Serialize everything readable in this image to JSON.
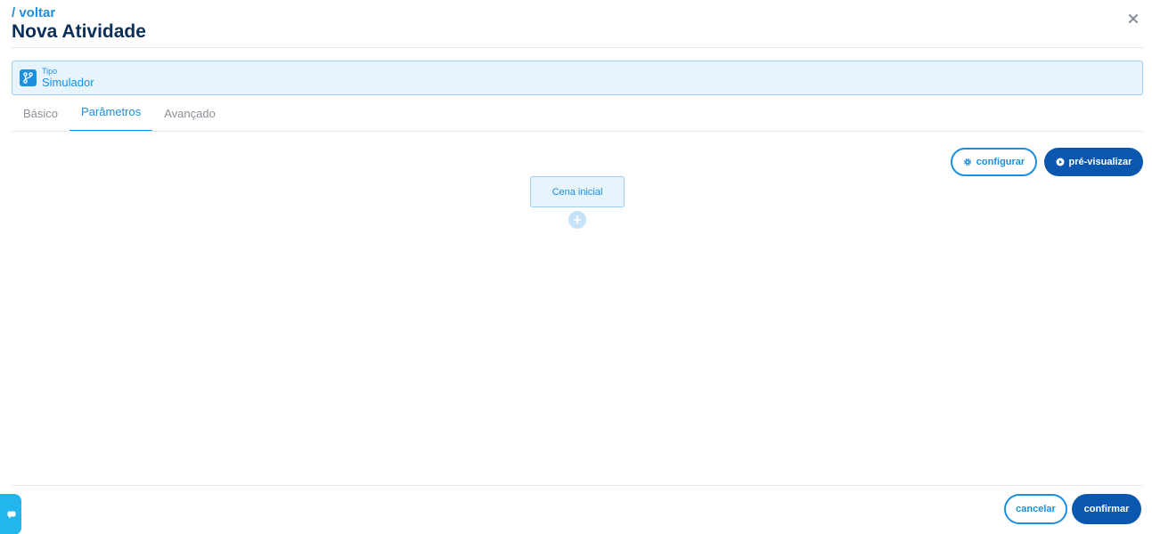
{
  "header": {
    "back_label": "/ voltar",
    "title": "Nova Atividade",
    "close_icon": "close-icon"
  },
  "type_field": {
    "caption": "Tipo",
    "value": "Simulador",
    "icon": "branch-icon"
  },
  "tabs": [
    {
      "label": "Básico",
      "active": false
    },
    {
      "label": "Parâmetros",
      "active": true
    },
    {
      "label": "Avançado",
      "active": false
    }
  ],
  "toolbar": {
    "configure_label": "configurar",
    "configure_icon": "gear-icon",
    "preview_label": "pré-visualizar",
    "preview_icon": "play-icon"
  },
  "flow": {
    "initial_scene_label": "Cena inicial",
    "add_icon": "plus-icon"
  },
  "footer": {
    "cancel_label": "cancelar",
    "confirm_label": "confirmar"
  },
  "colors": {
    "primary": "#1b8fe0",
    "primary_dark": "#0b57b0",
    "title": "#0b2f57",
    "light_bg": "#e8f4fc",
    "chat": "#22b6ec"
  }
}
